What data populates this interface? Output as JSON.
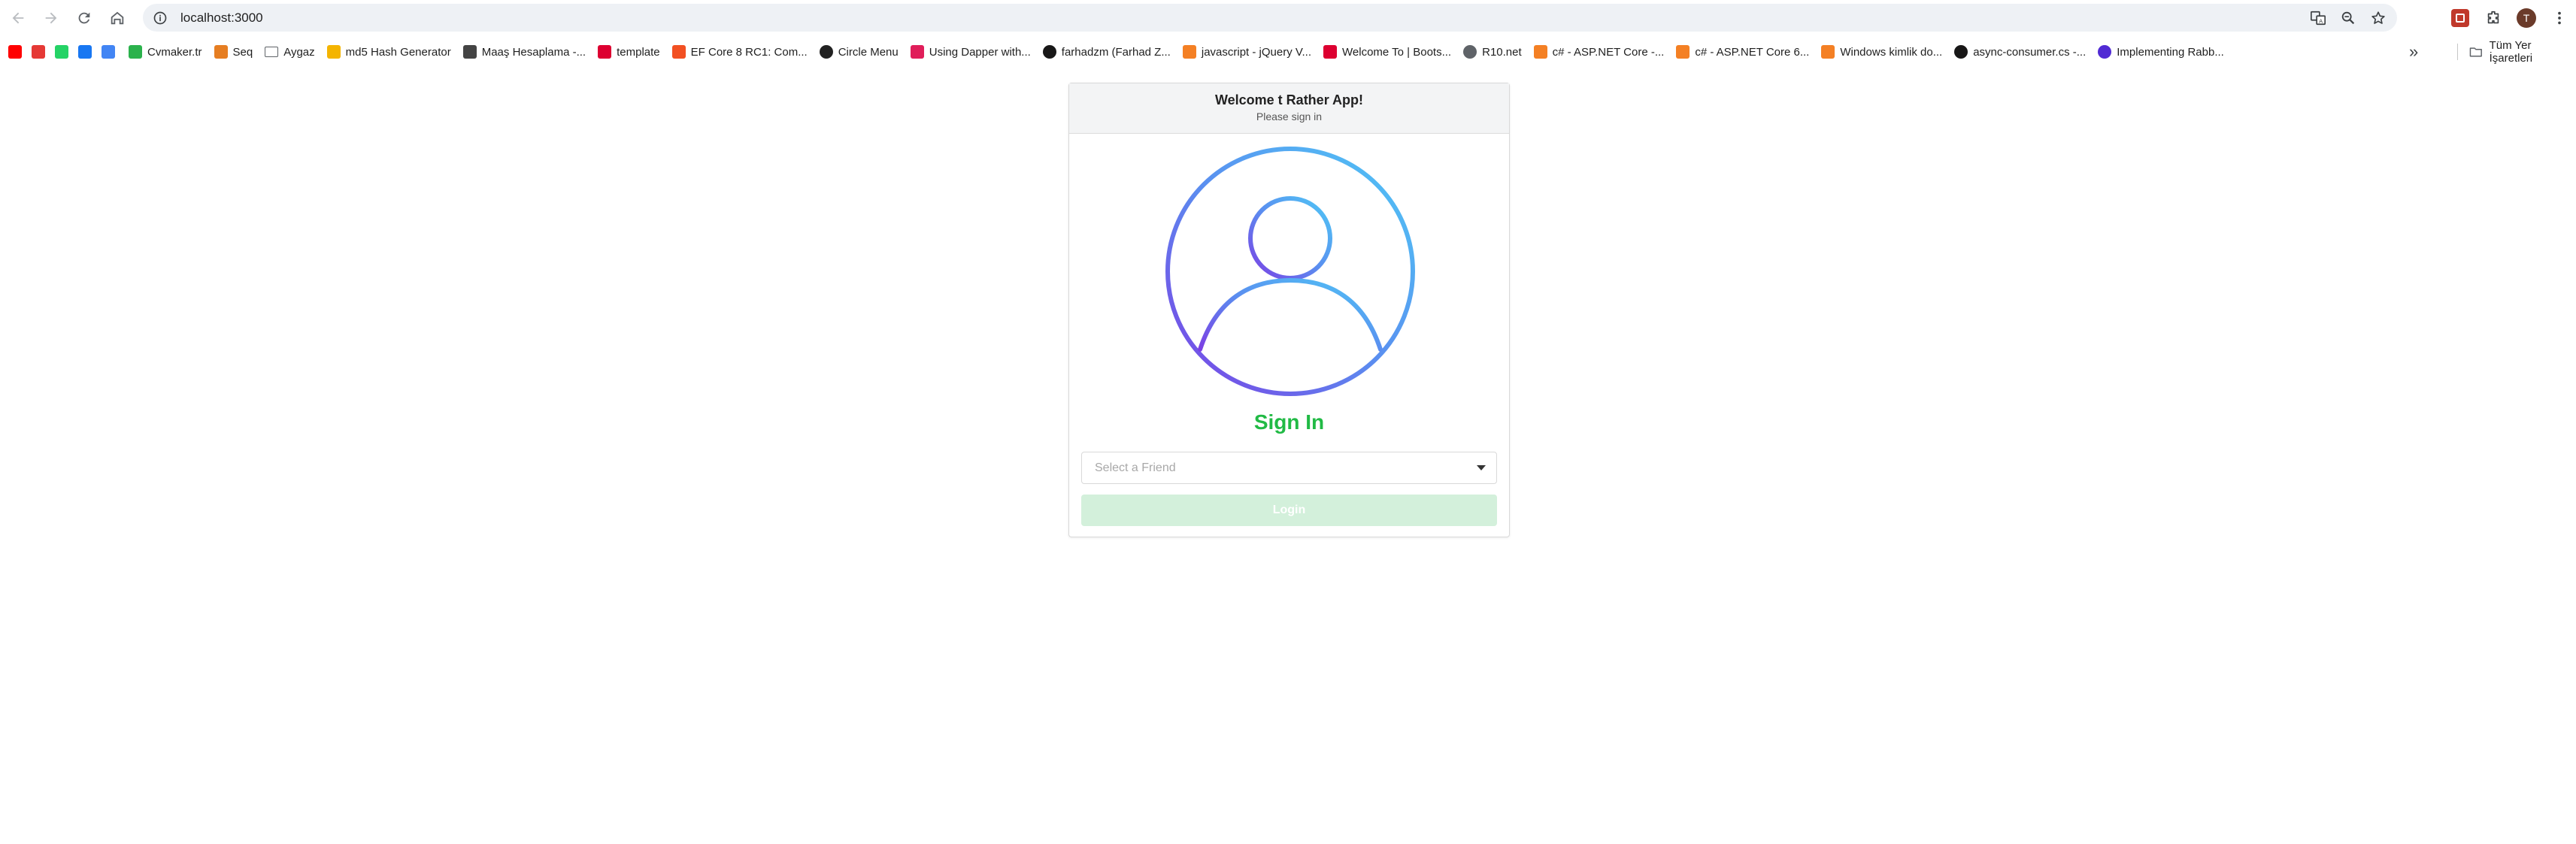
{
  "browser": {
    "url": "localhost:3000",
    "profile_initial": "T",
    "bookmarks": [
      {
        "label": "",
        "icon": "youtube-icon",
        "color": "#ff0000"
      },
      {
        "label": "",
        "icon": "flame-icon",
        "color": "#e53935"
      },
      {
        "label": "",
        "icon": "whatsapp-icon",
        "color": "#25d366"
      },
      {
        "label": "",
        "icon": "facebook-icon",
        "color": "#1877f2"
      },
      {
        "label": "",
        "icon": "translate-icon",
        "color": "#4285f4"
      },
      {
        "label": "Cvmaker.tr",
        "icon": "cvmaker-icon",
        "color": "#2bb24c"
      },
      {
        "label": "Seq",
        "icon": "seq-icon",
        "color": "#e67e22"
      },
      {
        "label": "Aygaz",
        "icon": "folder-icon",
        "color": "#5f6368"
      },
      {
        "label": "md5 Hash Generator",
        "icon": "md5-icon",
        "color": "#f4b400"
      },
      {
        "label": "Maaş Hesaplama -...",
        "icon": "calculator-icon",
        "color": "#444444"
      },
      {
        "label": "template",
        "icon": "angular-icon",
        "color": "#dd0031"
      },
      {
        "label": "EF Core 8 RC1: Com...",
        "icon": "microsoft-icon",
        "color": "#f25022"
      },
      {
        "label": "Circle Menu",
        "icon": "codepen-icon",
        "color": "#222222"
      },
      {
        "label": "Using Dapper with...",
        "icon": "slack-icon",
        "color": "#e01e5a"
      },
      {
        "label": "farhadzm (Farhad Z...",
        "icon": "github-icon",
        "color": "#181717"
      },
      {
        "label": "javascript - jQuery V...",
        "icon": "stackoverflow-icon",
        "color": "#f48024"
      },
      {
        "label": "Welcome To | Boots...",
        "icon": "angular-icon",
        "color": "#dd0031"
      },
      {
        "label": "R10.net",
        "icon": "globe-icon",
        "color": "#5f6368"
      },
      {
        "label": "c# - ASP.NET Core -...",
        "icon": "stackoverflow-icon",
        "color": "#f48024"
      },
      {
        "label": "c# - ASP.NET Core 6...",
        "icon": "stackoverflow-icon",
        "color": "#f48024"
      },
      {
        "label": "Windows kimlik do...",
        "icon": "stackoverflow-icon",
        "color": "#f48024"
      },
      {
        "label": "async-consumer.cs -...",
        "icon": "github-icon",
        "color": "#181717"
      },
      {
        "label": "Implementing Rabb...",
        "icon": "dotnet-icon",
        "color": "#512bd4"
      }
    ],
    "overflow_label": "»",
    "other_bookmarks_label": "Tüm Yer İşaretleri"
  },
  "login": {
    "title": "Welcome t Rather App!",
    "subtitle": "Please sign in",
    "heading": "Sign In",
    "select_placeholder": "Select a Friend",
    "button_label": "Login",
    "heading_color": "#21ba45",
    "button_color": "#d3f0db"
  }
}
